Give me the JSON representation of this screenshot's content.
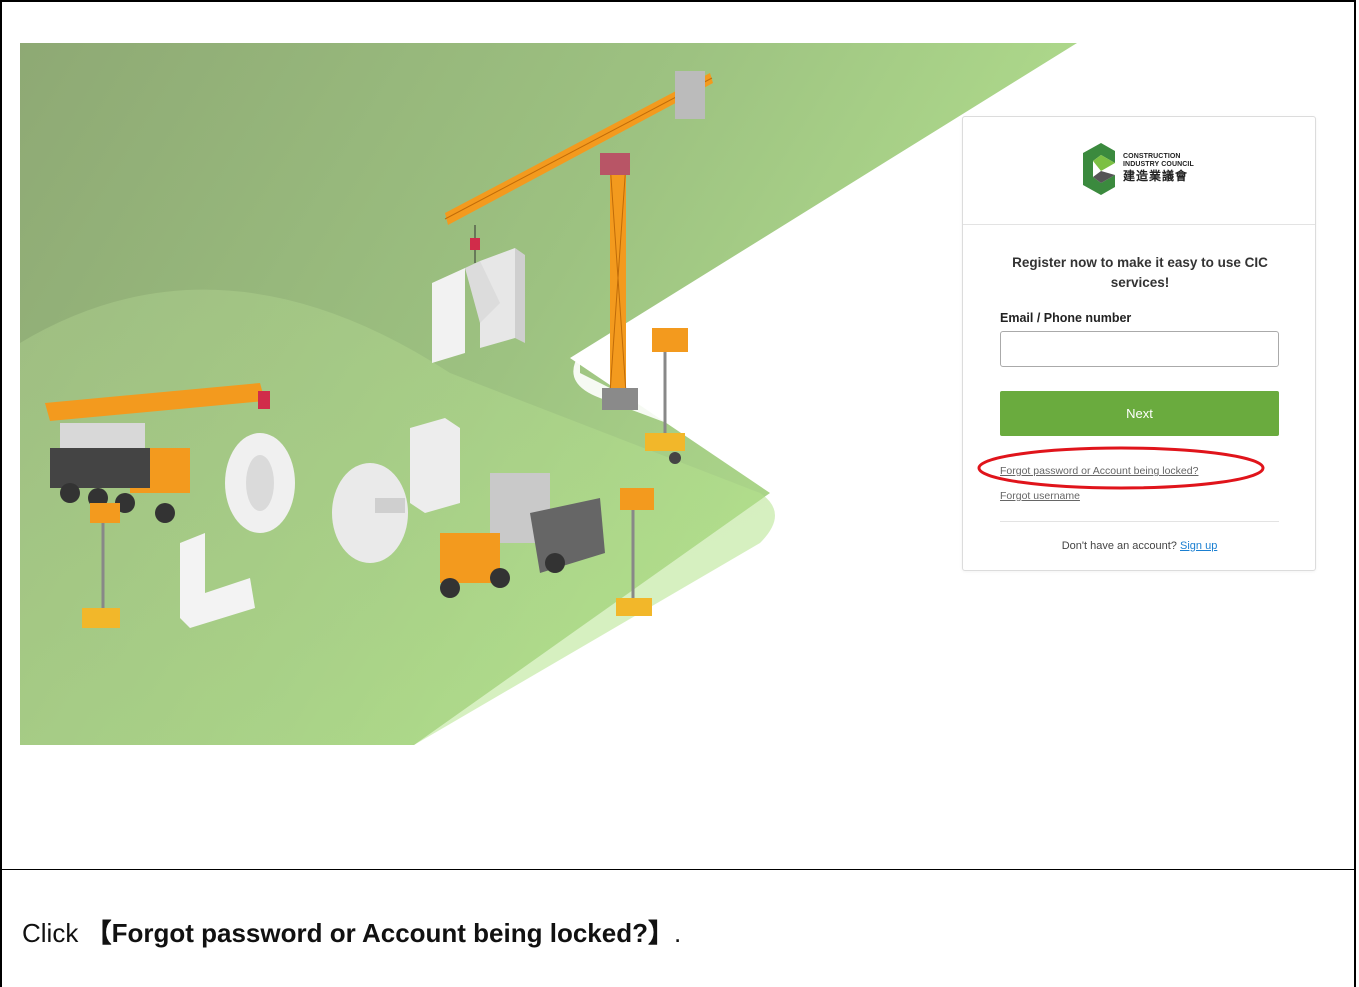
{
  "logo": {
    "line1": "CONSTRUCTION",
    "line2": "INDUSTRY COUNCIL",
    "zh": "建造業議會"
  },
  "login": {
    "register_text": "Register now to make it easy to use CIC services!",
    "email_label": "Email / Phone number",
    "email_value": "",
    "next_label": "Next",
    "forgot_password_label": "Forgot password or Account being locked?",
    "forgot_username_label": "Forgot username",
    "no_account_text": "Don't have an account?",
    "signup_label": "Sign up"
  },
  "instruction": {
    "prefix": "Click ",
    "open_bracket": "【",
    "bold_text": "Forgot password or Account being locked?",
    "close_bracket": "】",
    "suffix": "."
  },
  "colors": {
    "accent_green": "#6aab3e",
    "highlight_red": "#e0141b",
    "link_blue": "#1a7fd1"
  }
}
